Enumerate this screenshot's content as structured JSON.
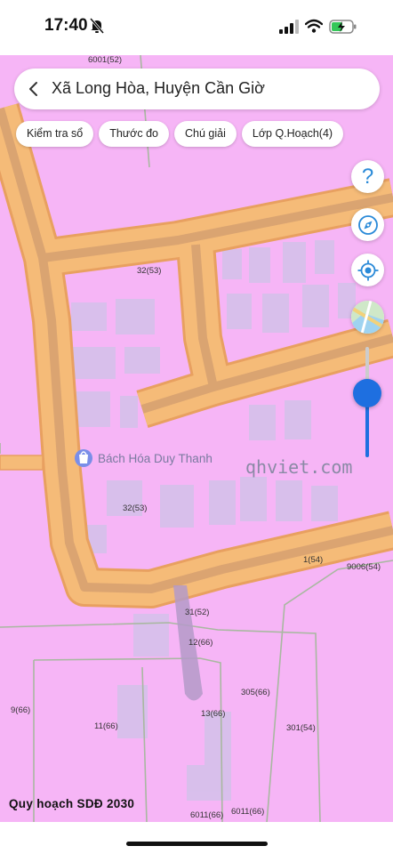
{
  "status_bar": {
    "time": "17:40",
    "battery_charging": true
  },
  "search": {
    "title": "Xã Long Hòa, Huyện Cần Giờ"
  },
  "chips": [
    {
      "label": "Kiểm tra sổ"
    },
    {
      "label": "Thước đo"
    },
    {
      "label": "Chú giải"
    },
    {
      "label": "Lớp Q.Hoạch(4)"
    }
  ],
  "controls": {
    "help_glyph": "?",
    "zoom_level": 0.58,
    "icons": [
      "help-icon",
      "compass-icon",
      "locate-icon",
      "map-type-icon"
    ]
  },
  "map": {
    "poi": {
      "name": "Bách Hóa Duy Thanh",
      "icon": "shopping-bag-icon"
    },
    "watermark": "qhviet.com",
    "parcels": [
      "6001(52)",
      "32(53)",
      "32(53)",
      "1(54)",
      "9006(54)",
      "31(52)",
      "12(66)",
      "305(66)",
      "9(66)",
      "11(66)",
      "13(66)",
      "301(54)",
      "6011(66)",
      "6011(66)"
    ],
    "colors": {
      "land": "#f6b5f6",
      "road": "#f5bb78",
      "road_edge": "#e8a060",
      "road_center": "#d6a070",
      "building": "#cfc3e8",
      "boundary": "#a8b8a0"
    }
  },
  "layer_label": "Quy hoạch SDĐ 2030"
}
